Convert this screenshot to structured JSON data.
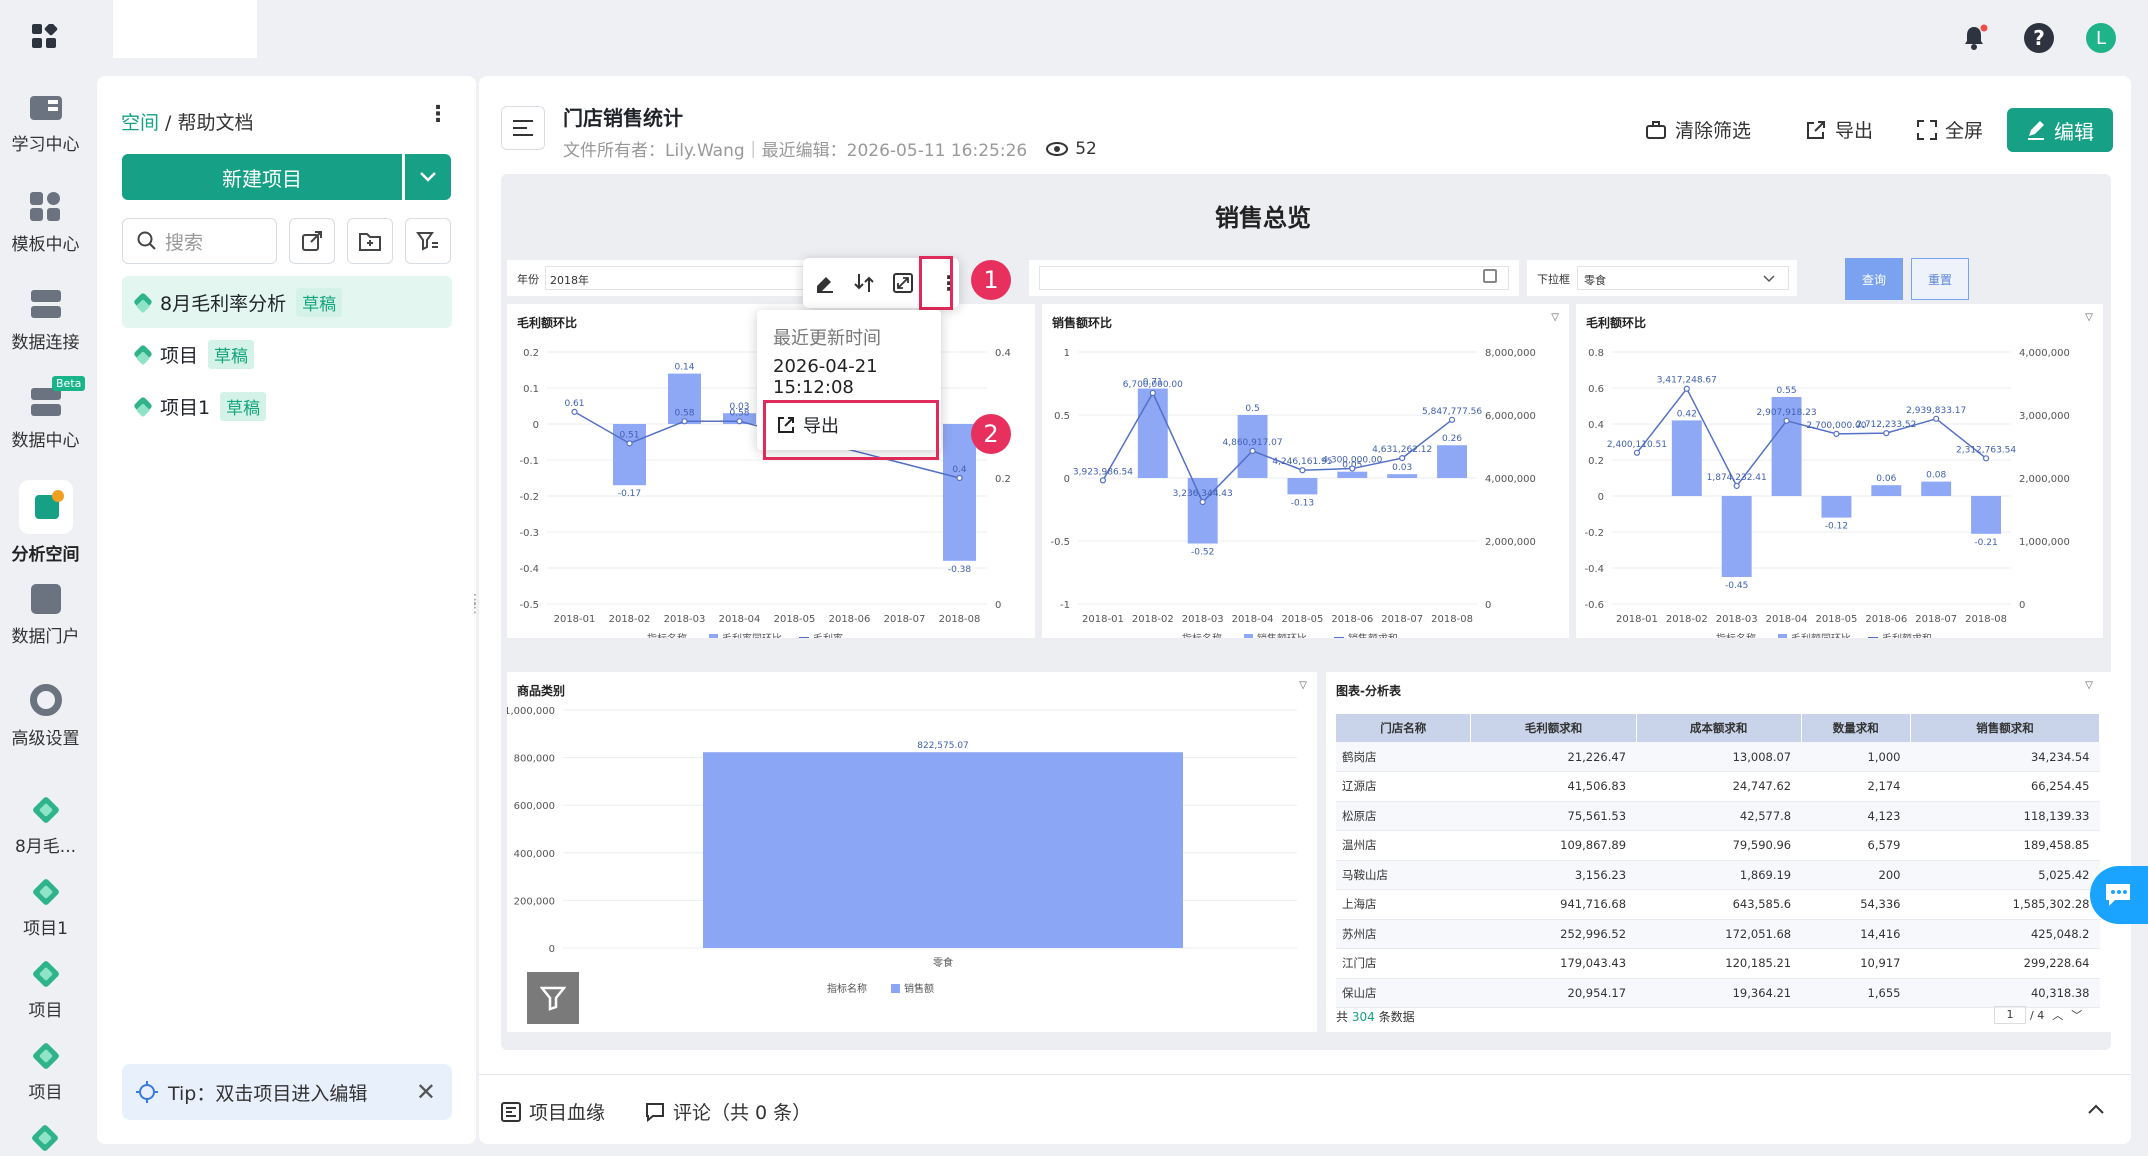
{
  "rail": {
    "items": [
      {
        "label": "学习中心",
        "icon": "book-icon"
      },
      {
        "label": "模板中心",
        "icon": "template-icon"
      },
      {
        "label": "数据连接",
        "icon": "database-icon"
      },
      {
        "label": "数据中心",
        "icon": "data-center-icon",
        "badge": "Beta"
      },
      {
        "label": "分析空间",
        "icon": "analysis-icon"
      },
      {
        "label": "数据门户",
        "icon": "portal-icon"
      },
      {
        "label": "高级设置",
        "icon": "gear-icon"
      },
      {
        "label": "8月毛...",
        "icon": "project-icon"
      },
      {
        "label": "项目1",
        "icon": "project-icon"
      },
      {
        "label": "项目",
        "icon": "project-icon"
      },
      {
        "label": "项目",
        "icon": "project-icon"
      }
    ]
  },
  "topbar": {
    "avatar": "L"
  },
  "left": {
    "breadcrumb_space": "空间",
    "breadcrumb_sep": " / ",
    "breadcrumb_page": "帮助文档",
    "new_project": "新建项目",
    "search_placeholder": "搜索",
    "projects": [
      {
        "name": "8月毛利率分析",
        "tag": "草稿"
      },
      {
        "name": "项目",
        "tag": "草稿"
      },
      {
        "name": "项目1",
        "tag": "草稿"
      }
    ],
    "tip": "Tip：双击项目进入编辑"
  },
  "header": {
    "title": "门店销售统计",
    "meta": "文件所有者：Lily.Wang｜最近编辑：2026-05-11 16:25:26",
    "views": "52",
    "clear_filter": "清除筛选",
    "export": "导出",
    "fullscreen": "全屏",
    "edit": "编辑"
  },
  "dashboard": {
    "title": "销售总览",
    "filter_year_label": "年份",
    "filter_year_value": "2018年",
    "filter_dropdown_label": "下拉框",
    "filter_dropdown_value": "零食",
    "query": "查询",
    "reset": "重置",
    "popup_header": "最近更新时间",
    "popup_time": "2026-04-21 15:12:08",
    "popup_export": "导出",
    "badge1": "1",
    "badge2": "2"
  },
  "charts": {
    "c1": {
      "title": "毛利额环比",
      "legend_label": "指标名称",
      "legend_a": "毛利率同环比",
      "legend_b": "毛利率"
    },
    "c2": {
      "title": "销售额环比",
      "legend_label": "指标名称",
      "legend_a": "销售额环比",
      "legend_b": "销售额求和"
    },
    "c3": {
      "title": "毛利额环比",
      "legend_label": "指标名称",
      "legend_a": "毛利额同环比",
      "legend_b": "毛利额求和"
    },
    "c4": {
      "title": "商品类别",
      "legend_label": "指标名称",
      "legend_a": "销售额",
      "bar_label": "822,575.07",
      "category": "零食"
    },
    "c5": {
      "title": "图表-分析表",
      "total_prefix": "共",
      "total_count": "304",
      "total_suffix": "条数据",
      "page_value": "1",
      "page_total": "/ 4"
    }
  },
  "chart_data": [
    {
      "type": "bar",
      "title": "毛利额环比",
      "categories": [
        "2018-01",
        "2018-02",
        "2018-03",
        "2018-04",
        "2018-05",
        "2018-06",
        "2018-07",
        "2018-08"
      ],
      "series": [
        {
          "name": "毛利率同环比",
          "values": [
            null,
            -0.17,
            0.14,
            0.03,
            null,
            null,
            null,
            -0.38
          ]
        },
        {
          "name": "毛利率",
          "type": "line",
          "values": [
            0.61,
            0.51,
            0.58,
            0.58,
            null,
            null,
            null,
            0.4
          ]
        }
      ],
      "yticks_left": [
        "0.2",
        "0.1",
        "0",
        "-0.1",
        "-0.2",
        "-0.3",
        "-0.4",
        "-0.5"
      ],
      "yticks_right": [
        "0.4",
        "0.2",
        "0"
      ]
    },
    {
      "type": "bar",
      "title": "销售额环比",
      "categories": [
        "2018-01",
        "2018-02",
        "2018-03",
        "2018-04",
        "2018-05",
        "2018-06",
        "2018-07",
        "2018-08"
      ],
      "series": [
        {
          "name": "销售额环比",
          "values": [
            null,
            0.71,
            -0.52,
            0.5,
            -0.13,
            0.05,
            0.03,
            0.26
          ]
        },
        {
          "name": "销售额求和",
          "type": "line",
          "values": [
            3923986.54,
            6700000,
            3236344.43,
            4860917.07,
            4246161.95,
            4300000,
            4631262.12,
            5847777.56
          ]
        }
      ],
      "yticks_left": [
        "1",
        "0.5",
        "0",
        "-0.5",
        "-1"
      ],
      "yticks_right": [
        "8,000,000",
        "6,000,000",
        "4,000,000",
        "2,000,000",
        "0"
      ],
      "labels": [
        "3,923,986.54",
        "0.71",
        "3,236,344.43",
        "-0.52",
        "4,860,917.07",
        "0.5",
        "4,246,161.95",
        "-0.13",
        "0.05",
        "0.03",
        "4,631,262.12",
        "5,847,777.56",
        "0.26"
      ]
    },
    {
      "type": "bar",
      "title": "毛利额环比",
      "categories": [
        "2018-01",
        "2018-02",
        "2018-03",
        "2018-04",
        "2018-05",
        "2018-06",
        "2018-07",
        "2018-08"
      ],
      "series": [
        {
          "name": "毛利额同环比",
          "values": [
            null,
            0.42,
            -0.45,
            0.55,
            -0.12,
            0.06,
            0.08,
            -0.21
          ]
        },
        {
          "name": "毛利额求和",
          "type": "line",
          "values": [
            2400110.51,
            3417248.67,
            1874232.41,
            2907918.23,
            2700000,
            2712233.52,
            2939833.17,
            2312763.54
          ]
        }
      ],
      "yticks_left": [
        "0.8",
        "0.6",
        "0.4",
        "0.2",
        "0",
        "-0.2",
        "-0.4",
        "-0.6"
      ],
      "yticks_right": [
        "4,000,000",
        "3,000,000",
        "2,000,000",
        "1,000,000",
        "0"
      ],
      "labels": [
        "2,400,110.51",
        "3,417,248.67",
        "0.42",
        "1,874,232.41",
        "-0.45",
        "2,907,918.23",
        "0.55",
        "-0.12",
        "2,712,233.52",
        "0.06",
        "2,939,833.17",
        "0.08",
        "2,312,763.54",
        "-0.21"
      ]
    },
    {
      "type": "bar",
      "title": "商品类别",
      "categories": [
        "零食"
      ],
      "values": [
        822575.07
      ],
      "yticks": [
        "1,000,000",
        "800,000",
        "600,000",
        "400,000",
        "200,000",
        "0"
      ]
    },
    {
      "type": "table",
      "title": "图表-分析表",
      "columns": [
        "门店名称",
        "毛利额求和",
        "成本额求和",
        "数量求和",
        "销售额求和"
      ],
      "rows": [
        [
          "鹤岗店",
          "21,226.47",
          "13,008.07",
          "1,000",
          "34,234.54"
        ],
        [
          "辽源店",
          "41,506.83",
          "24,747.62",
          "2,174",
          "66,254.45"
        ],
        [
          "松原店",
          "75,561.53",
          "42,577.8",
          "4,123",
          "118,139.33"
        ],
        [
          "温州店",
          "109,867.89",
          "79,590.96",
          "6,579",
          "189,458.85"
        ],
        [
          "马鞍山店",
          "3,156.23",
          "1,869.19",
          "200",
          "5,025.42"
        ],
        [
          "上海店",
          "941,716.68",
          "643,585.6",
          "54,336",
          "1,585,302.28"
        ],
        [
          "苏州店",
          "252,996.52",
          "172,051.68",
          "14,416",
          "425,048.2"
        ],
        [
          "江门店",
          "179,043.43",
          "120,185.21",
          "10,917",
          "299,228.64"
        ],
        [
          "保山店",
          "20,954.17",
          "19,364.21",
          "1,655",
          "40,318.38"
        ]
      ]
    }
  ],
  "footer": {
    "lineage": "项目血缘",
    "comments": "评论（共 0 条）"
  }
}
